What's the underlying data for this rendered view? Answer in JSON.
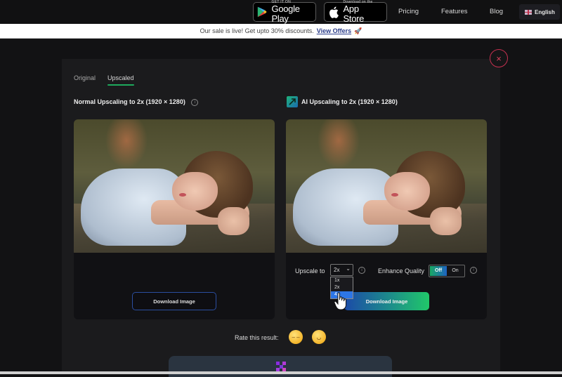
{
  "topnav": {
    "google_play": {
      "small": "GET IT ON",
      "big": "Google Play",
      "icon": "google-play-icon"
    },
    "app_store": {
      "small": "Download on the",
      "big": "App Store",
      "icon": "apple-icon"
    },
    "links": [
      "Pricing",
      "Features",
      "Blog"
    ],
    "language": {
      "label": "English",
      "icon": "uk-flag-icon"
    }
  },
  "promo": {
    "text": "Our sale is live! Get upto 30% discounts.",
    "link": "View Offers",
    "icon": "🚀"
  },
  "modal": {
    "close_icon": "×",
    "tabs": [
      {
        "label": "Original",
        "active": false
      },
      {
        "label": "Upscaled",
        "active": true
      }
    ],
    "left_panel": {
      "title": "Normal Upscaling to 2x (1920 × 1280)",
      "info_icon": "i",
      "download_label": "Download Image"
    },
    "right_panel": {
      "title": "AI Upscaling to 2x (1920 × 1280)",
      "upscale_label": "Upscale to",
      "upscale_value": "2x",
      "upscale_options": [
        "1x",
        "2x",
        "4x"
      ],
      "upscale_highlighted": "4x",
      "enhance_label": "Enhance Quality",
      "toggle_off": "Off",
      "toggle_on": "On",
      "toggle_state": "Off",
      "download_label": "Download Image"
    },
    "rating": {
      "label": "Rate this result:",
      "options": [
        "unhappy-face",
        "happy-face"
      ]
    }
  },
  "colors": {
    "accent_green": "#1ea95c",
    "accent_blue": "#2d76e6",
    "close_red": "#c4304f",
    "background": "#121214"
  }
}
